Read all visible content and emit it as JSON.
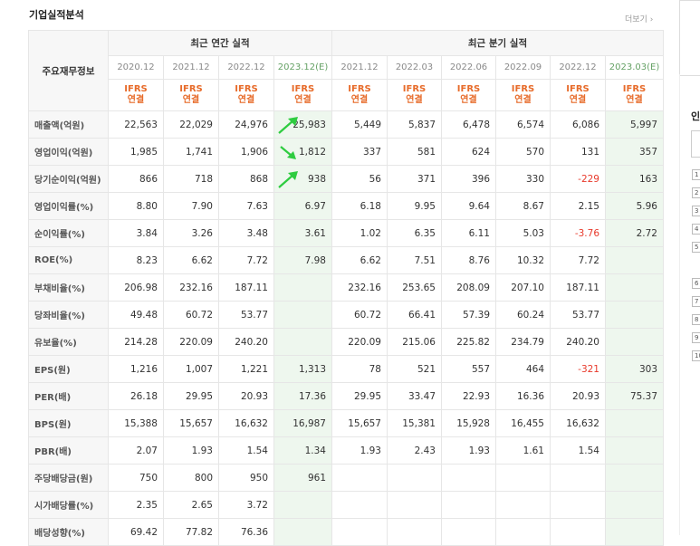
{
  "title": "기업실적분석",
  "more": "더보기",
  "corner_label": "주요재무정보",
  "annual_header": "최근 연간 실적",
  "quarter_header": "최근 분기 실적",
  "periods": [
    "2020.12",
    "2021.12",
    "2022.12",
    "2023.12(E)",
    "2021.12",
    "2022.03",
    "2022.06",
    "2022.09",
    "2022.12",
    "2023.03(E)"
  ],
  "ifrs_top": "IFRS",
  "ifrs_bottom": "연결",
  "rows": [
    {
      "label": "매출액(억원)",
      "values": [
        "22,563",
        "22,029",
        "24,976",
        "25,983",
        "5,449",
        "5,837",
        "6,478",
        "6,574",
        "6,086",
        "5,997"
      ],
      "arrow": "up"
    },
    {
      "label": "영업이익(억원)",
      "values": [
        "1,985",
        "1,741",
        "1,906",
        "1,812",
        "337",
        "581",
        "624",
        "570",
        "131",
        "357"
      ],
      "arrow": "down"
    },
    {
      "label": "당기순이익(억원)",
      "values": [
        "866",
        "718",
        "868",
        "938",
        "56",
        "371",
        "396",
        "330",
        "-229",
        "163"
      ],
      "arrow": "up"
    },
    {
      "label": "영업이익률(%)",
      "values": [
        "8.80",
        "7.90",
        "7.63",
        "6.97",
        "6.18",
        "9.95",
        "9.64",
        "8.67",
        "2.15",
        "5.96"
      ]
    },
    {
      "label": "순이익률(%)",
      "values": [
        "3.84",
        "3.26",
        "3.48",
        "3.61",
        "1.02",
        "6.35",
        "6.11",
        "5.03",
        "-3.76",
        "2.72"
      ]
    },
    {
      "label": "ROE(%)",
      "values": [
        "8.23",
        "6.62",
        "7.72",
        "7.98",
        "6.62",
        "7.51",
        "8.76",
        "10.32",
        "7.72",
        ""
      ]
    },
    {
      "label": "부채비율(%)",
      "values": [
        "206.98",
        "232.16",
        "187.11",
        "",
        "232.16",
        "253.65",
        "208.09",
        "207.10",
        "187.11",
        ""
      ]
    },
    {
      "label": "당좌비율(%)",
      "values": [
        "49.48",
        "60.72",
        "53.77",
        "",
        "60.72",
        "66.41",
        "57.39",
        "60.24",
        "53.77",
        ""
      ]
    },
    {
      "label": "유보율(%)",
      "values": [
        "214.28",
        "220.09",
        "240.20",
        "",
        "220.09",
        "215.06",
        "225.82",
        "234.79",
        "240.20",
        ""
      ]
    },
    {
      "label": "EPS(원)",
      "values": [
        "1,216",
        "1,007",
        "1,221",
        "1,313",
        "78",
        "521",
        "557",
        "464",
        "-321",
        "303"
      ]
    },
    {
      "label": "PER(배)",
      "values": [
        "26.18",
        "29.95",
        "20.93",
        "17.36",
        "29.95",
        "33.47",
        "22.93",
        "16.36",
        "20.93",
        "75.37"
      ]
    },
    {
      "label": "BPS(원)",
      "values": [
        "15,388",
        "15,657",
        "16,632",
        "16,987",
        "15,657",
        "15,381",
        "15,928",
        "16,455",
        "16,632",
        ""
      ]
    },
    {
      "label": "PBR(배)",
      "values": [
        "2.07",
        "1.93",
        "1.54",
        "1.34",
        "1.93",
        "2.43",
        "1.93",
        "1.61",
        "1.54",
        ""
      ]
    },
    {
      "label": "주당배당금(원)",
      "values": [
        "750",
        "800",
        "950",
        "961",
        "",
        "",
        "",
        "",
        "",
        ""
      ]
    },
    {
      "label": "시가배당률(%)",
      "values": [
        "2.35",
        "2.65",
        "3.72",
        "",
        "",
        "",
        "",
        "",
        "",
        ""
      ]
    },
    {
      "label": "배당성향(%)",
      "values": [
        "69.42",
        "77.82",
        "76.36",
        "",
        "",
        "",
        "",
        "",
        "",
        ""
      ]
    }
  ],
  "colors": {
    "accent_ifrs": "#e76b2a",
    "negative": "#e8392b",
    "estimate_bg": "#eef7ee",
    "arrow_up": "#2ecc40",
    "arrow_down": "#2ecc40"
  },
  "side": {
    "label": "인",
    "numbers": [
      "1",
      "2",
      "3",
      "4",
      "5",
      "6",
      "7",
      "8",
      "9",
      "10"
    ]
  }
}
